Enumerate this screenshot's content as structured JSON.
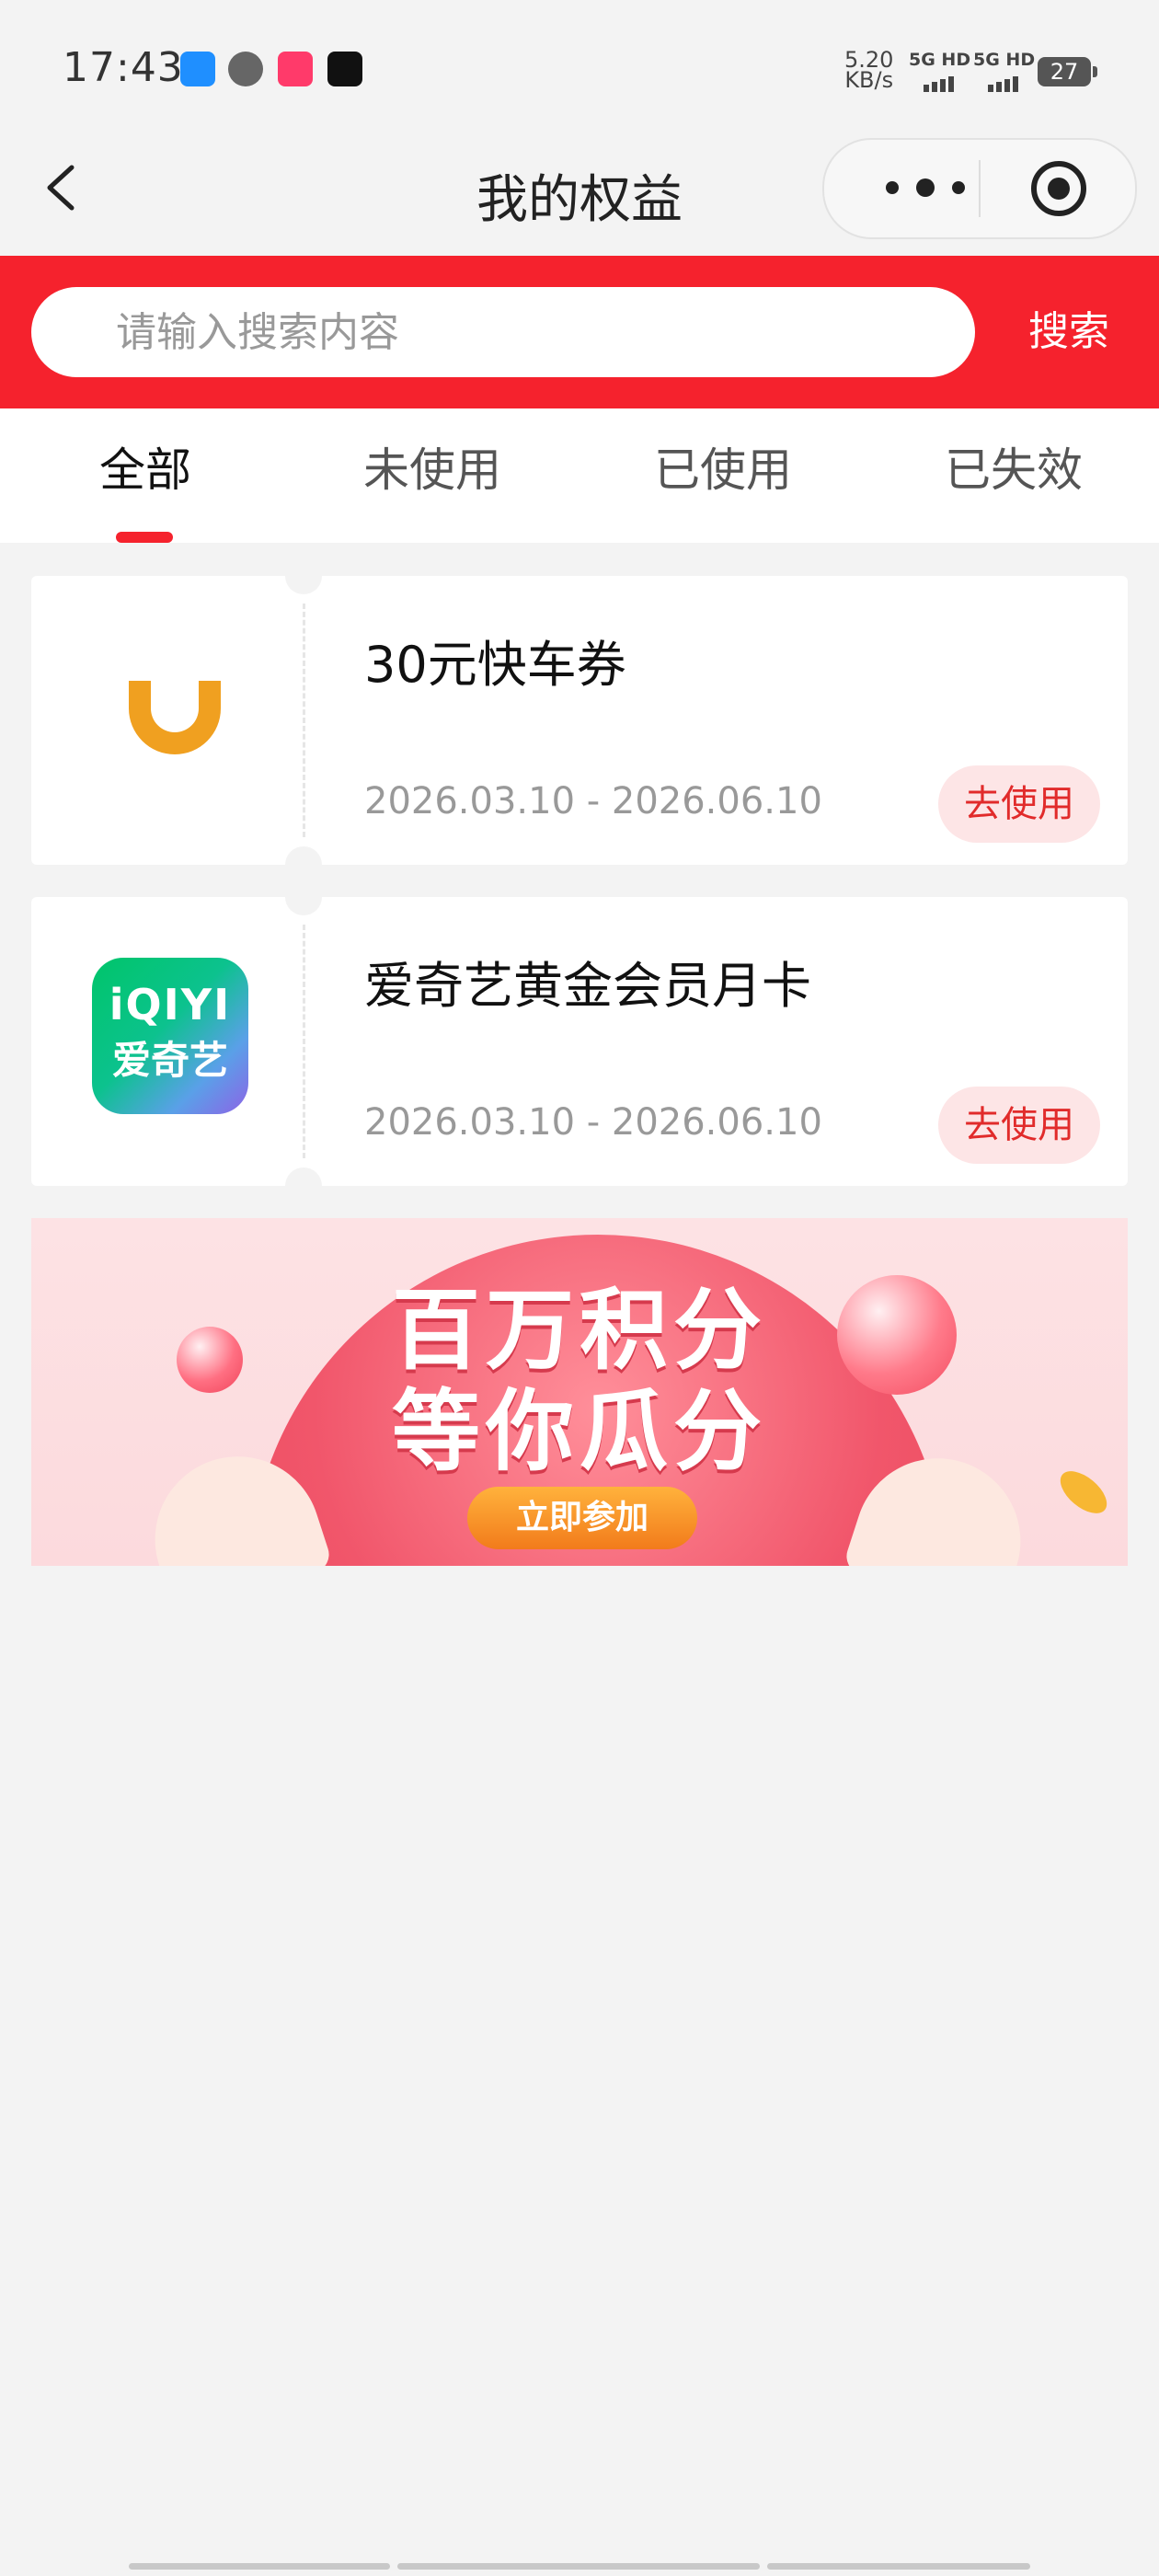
{
  "status_bar": {
    "time": "17:43",
    "net_speed_value": "5.20",
    "net_speed_unit": "KB/s",
    "sim1_label": "5G HD",
    "sim2_label": "5G HD",
    "battery": "27"
  },
  "nav": {
    "title": "我的权益",
    "back_icon": "chevron-left-icon",
    "more_icon": "more-dots-icon",
    "close_icon": "target-circle-icon"
  },
  "search": {
    "placeholder": "请输入搜索内容",
    "value": "",
    "button_label": "搜索",
    "bar_color": "#f5222d"
  },
  "tabs": [
    {
      "label": "全部",
      "active": true
    },
    {
      "label": "未使用",
      "active": false
    },
    {
      "label": "已使用",
      "active": false
    },
    {
      "label": "已失效",
      "active": false
    }
  ],
  "coupons": [
    {
      "title": "30元快车券",
      "date_range": "2026.03.10 - 2026.06.10",
      "button_label": "去使用",
      "logo": "didi-logo-icon"
    },
    {
      "title": "爱奇艺黄金会员月卡",
      "date_range": "2026.03.10 - 2026.06.10",
      "button_label": "去使用",
      "logo": "iqiyi-logo-icon",
      "logo_text_line1": "iQIYI",
      "logo_text_line2": "爱奇艺"
    }
  ],
  "banner": {
    "line1": "百万积分",
    "line2": "等你瓜分",
    "cta_label": "立即参加"
  },
  "colors": {
    "accent": "#f5222d",
    "use_button_bg": "#fde5e6",
    "use_button_text": "#e12b2b",
    "didi_orange": "#f0a020"
  }
}
